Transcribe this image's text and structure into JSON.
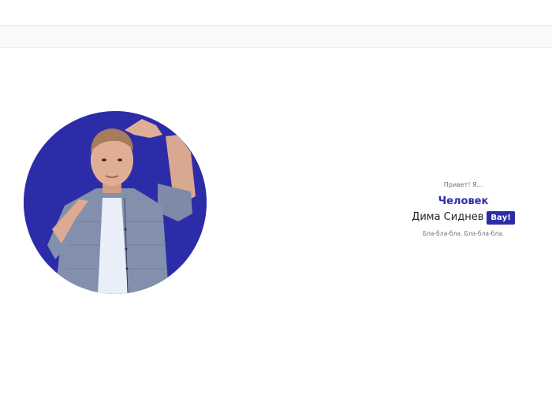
{
  "hero": {
    "greeting": "Привет! Я...",
    "role": "Человек",
    "name": "Дима Сиднев",
    "badge": "Вау!",
    "tagline": "Бла-бла-бла. Бла-бла-бла."
  },
  "colors": {
    "accent": "#2d2ca8",
    "navbar_bg": "#f8f9fa",
    "muted_text": "#6c757d",
    "body_text": "#212529"
  },
  "icons": {
    "avatar": "person-photo-avatar"
  }
}
